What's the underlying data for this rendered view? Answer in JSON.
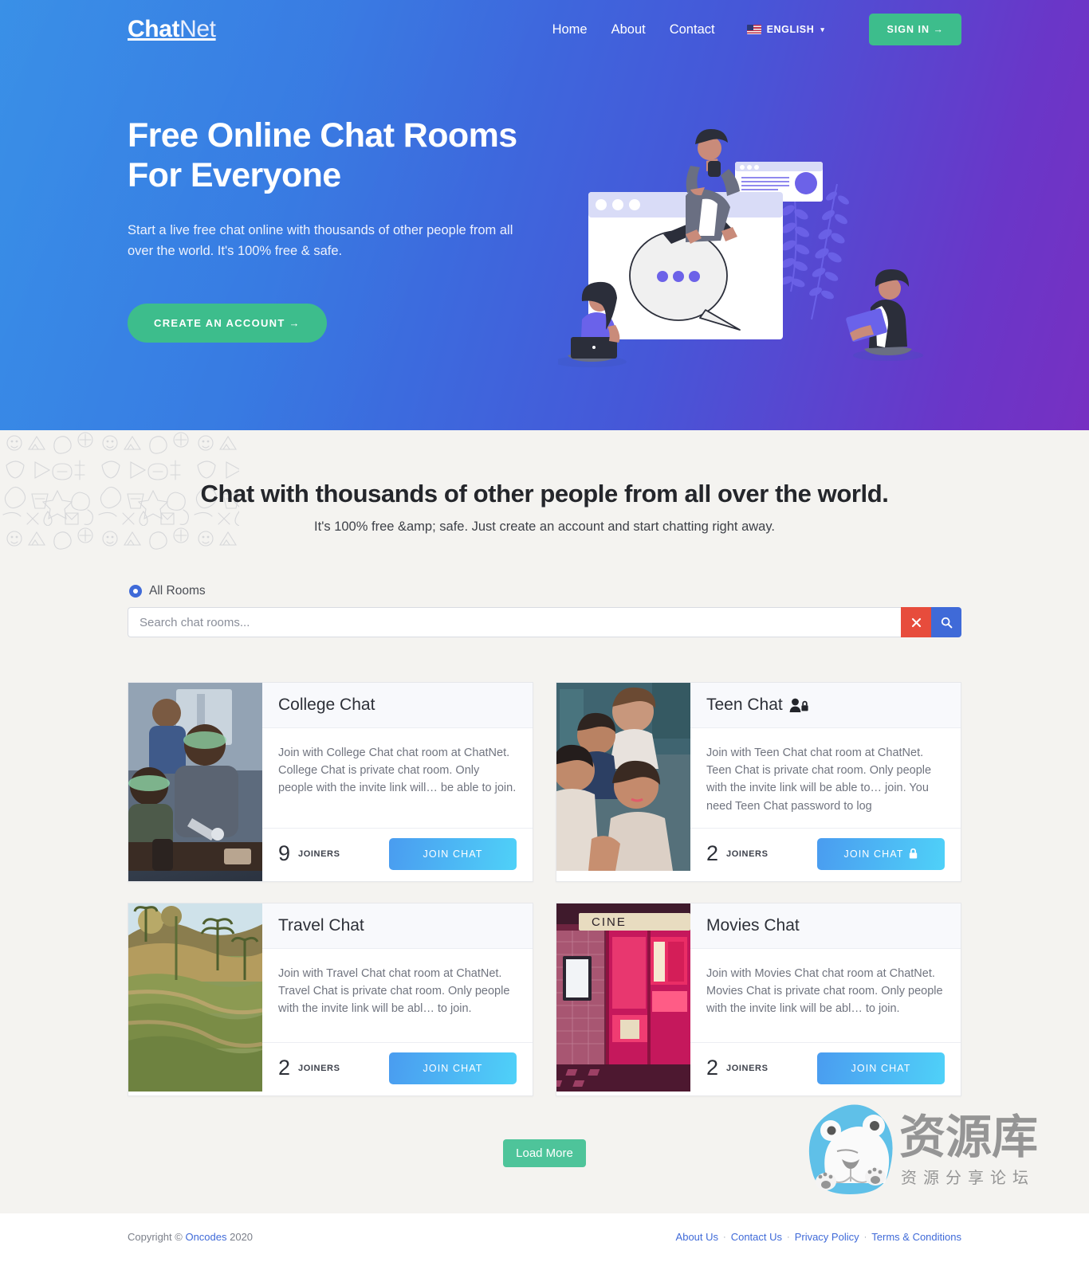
{
  "brand": {
    "bold": "Chat",
    "light": "Net"
  },
  "nav": {
    "links": [
      {
        "label": "Home"
      },
      {
        "label": "About"
      },
      {
        "label": "Contact"
      }
    ],
    "language": {
      "label": "ENGLISH",
      "flag_icon": "us-flag-icon",
      "caret": "▾"
    },
    "signin_label": "SIGN IN →"
  },
  "hero": {
    "title_line1": "Free Online Chat Rooms",
    "title_line2": "For Everyone",
    "subtitle": "Start a live free chat online with thousands of other people from all over the world. It's 100% free & safe.",
    "cta_label": "CREATE AN ACCOUNT →"
  },
  "rooms_section": {
    "title": "Chat with thousands of other people from all over the world.",
    "subtitle": "It's 100% free &amp; safe. Just create an account and start chatting right away.",
    "filter": {
      "radio_label": "All Rooms",
      "selected": true
    },
    "search": {
      "placeholder": "Search chat rooms...",
      "value": "",
      "clear_icon": "close-x-icon",
      "search_icon": "magnifier-icon"
    },
    "load_more_label": "Load More"
  },
  "rooms": [
    {
      "title": "College Chat",
      "private": false,
      "description": "Join with College Chat chat room at ChatNet. College Chat is private chat room. Only people with the invite link will… be able to join.",
      "joiners_count": "9",
      "joiners_label": "JOINERS",
      "join_label": "JOIN CHAT",
      "locked_button": false,
      "thumb": "college-classroom-photo"
    },
    {
      "title": "Teen Chat",
      "private": true,
      "description": "Join with Teen Chat chat room at ChatNet. Teen Chat is private chat room. Only people with the invite link will be able to… join. You need Teen Chat password to log",
      "joiners_count": "2",
      "joiners_label": "JOINERS",
      "join_label": "JOIN CHAT",
      "locked_button": true,
      "thumb": "teen-friends-photo"
    },
    {
      "title": "Travel Chat",
      "private": false,
      "description": "Join with Travel Chat chat room at ChatNet. Travel Chat is private chat room. Only people with the invite link will be abl… to join.",
      "joiners_count": "2",
      "joiners_label": "JOINERS",
      "join_label": "JOIN CHAT",
      "locked_button": false,
      "thumb": "rice-terrace-photo"
    },
    {
      "title": "Movies Chat",
      "private": false,
      "description": "Join with Movies Chat chat room at ChatNet. Movies Chat is private chat room. Only people with the invite link will be abl… to join.",
      "joiners_count": "2",
      "joiners_label": "JOINERS",
      "join_label": "JOIN CHAT",
      "locked_button": false,
      "thumb": "cinema-neon-photo"
    }
  ],
  "watermark": {
    "main_text": "资源库",
    "sub_text": "资 源 分 享 论 坛",
    "logo_icon": "bear-logo-icon"
  },
  "footer": {
    "copyright_prefix": "Copyright © ",
    "copyright_link": "Oncodes",
    "copyright_suffix": " 2020",
    "links": [
      {
        "label": "About Us"
      },
      {
        "label": "Contact Us"
      },
      {
        "label": "Privacy Policy"
      },
      {
        "label": "Terms & Conditions"
      }
    ],
    "separator": "·"
  },
  "colors": {
    "hero_gradient_start": "#2f8ae6",
    "hero_gradient_end": "#7730c2",
    "green_accent": "#3dbd8c",
    "blue_accent": "#3f6ad8",
    "red_accent": "#e74c3c",
    "join_btn_start": "#4a9cf0",
    "join_btn_end": "#4fd1f8",
    "section_bg": "#f4f3f0"
  }
}
